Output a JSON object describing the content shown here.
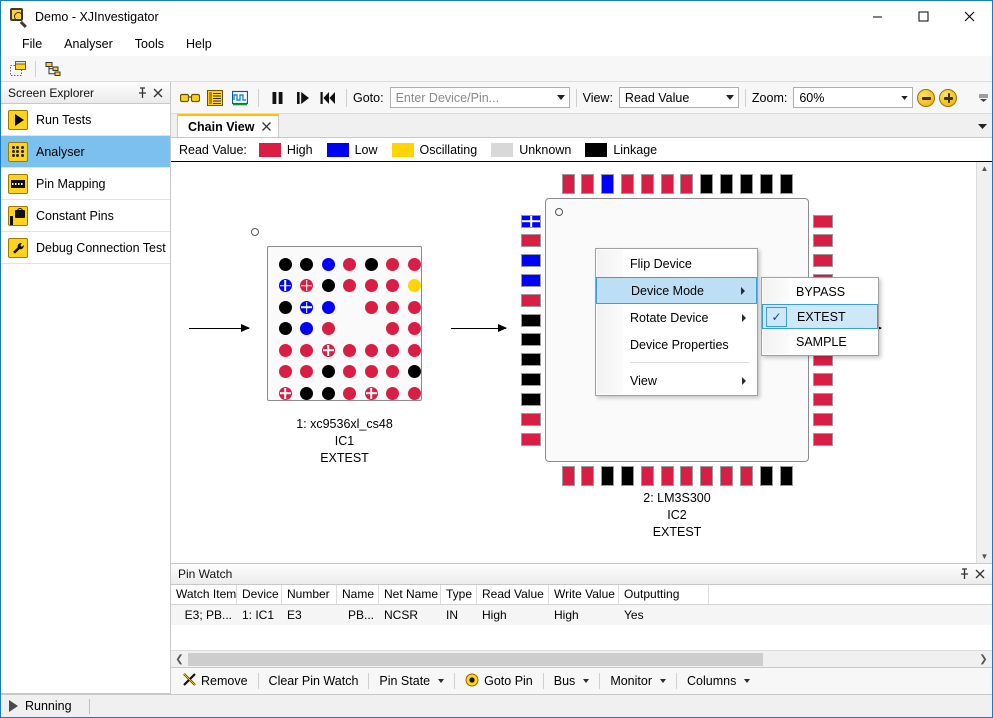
{
  "window": {
    "title": "Demo - XJInvestigator",
    "app_icon": "magnifier-icon",
    "minimize": "minimize-icon",
    "maximize": "maximize-icon",
    "close": "close-icon"
  },
  "menubar": {
    "items": [
      "File",
      "Analyser",
      "Tools",
      "Help"
    ]
  },
  "top_toolbar": {
    "buttons": [
      "screen-explorer-icon",
      "hierarchy-icon"
    ]
  },
  "sidebar": {
    "title": "Screen Explorer",
    "pin_icon": "pin-icon",
    "close_icon": "close-icon",
    "items": [
      {
        "label": "Run Tests",
        "icon": "run-tests-icon",
        "selected": false
      },
      {
        "label": "Analyser",
        "icon": "analyser-icon",
        "selected": true
      },
      {
        "label": "Pin Mapping",
        "icon": "pin-mapping-icon",
        "selected": false
      },
      {
        "label": "Constant Pins",
        "icon": "constant-pins-icon",
        "selected": false
      },
      {
        "label": "Debug Connection Test",
        "icon": "debug-connection-icon",
        "selected": false
      }
    ]
  },
  "main_toolbar": {
    "icon_buttons": [
      "glasses-icon",
      "list-view-icon",
      "waveform-icon"
    ],
    "transport_buttons": [
      "pause-icon",
      "step-icon",
      "rewind-icon"
    ],
    "goto_label": "Goto:",
    "goto_placeholder": "Enter Device/Pin...",
    "goto_value": "",
    "view_label": "View:",
    "view_value": "Read Value",
    "zoom_label": "Zoom:",
    "zoom_value": "60%",
    "zoom_out_icon": "zoom-out-icon",
    "zoom_in_icon": "zoom-in-icon",
    "overflow_icon": "toolbar-overflow-icon"
  },
  "tabs": {
    "items": [
      {
        "label": "Chain View",
        "close_icon": "close-icon",
        "active": true
      }
    ],
    "dropdown_icon": "chevron-down-icon"
  },
  "legend": {
    "title": "Read Value:",
    "items": [
      {
        "label": "High",
        "color": "#D81E45"
      },
      {
        "label": "Low",
        "color": "#0000FF"
      },
      {
        "label": "Oscillating",
        "color": "#FFD400"
      },
      {
        "label": "Unknown",
        "color": "#D8D8D8"
      },
      {
        "label": "Linkage",
        "color": "#000000"
      }
    ]
  },
  "canvas": {
    "device1": {
      "name": "1: xc9536xl_cs48",
      "ref": "IC1",
      "mode": "EXTEST",
      "package": "BGA",
      "grid": [
        [
          "K",
          "K",
          "L",
          "H",
          "K",
          "H",
          "H"
        ],
        [
          "Lx",
          "Hx",
          "K",
          "H",
          "H",
          "H",
          "O"
        ],
        [
          "K",
          "Lx",
          "L",
          "",
          "H",
          "H",
          "H"
        ],
        [
          "K",
          "L",
          "H",
          "",
          "",
          "H",
          "H"
        ],
        [
          "H",
          "H",
          "Hx",
          "H",
          "H",
          "H",
          "H"
        ],
        [
          "H",
          "H",
          "K",
          "H",
          "H",
          "H",
          "K"
        ],
        [
          "Hx",
          "K",
          "K",
          "H",
          "Hx",
          "H",
          "H"
        ]
      ]
    },
    "device2": {
      "name": "2: LM3S300",
      "ref": "IC2",
      "mode": "EXTEST",
      "package": "QFP",
      "top_pins": [
        "H",
        "H",
        "L",
        "H",
        "H",
        "H",
        "H",
        "K",
        "K",
        "K",
        "K",
        "K"
      ],
      "bottom_pins": [
        "H",
        "H",
        "K",
        "K",
        "H",
        "H",
        "H",
        "H",
        "H",
        "H",
        "K",
        "K"
      ],
      "left_pins": [
        "Lx",
        "H",
        "L",
        "L",
        "H",
        "K",
        "K",
        "K",
        "K",
        "K",
        "H",
        "H"
      ],
      "right_pins": [
        "H",
        "H",
        "H",
        "H",
        "H",
        "H",
        "H",
        "H",
        "H",
        "H",
        "H",
        "H"
      ]
    }
  },
  "context_menu": {
    "items": [
      {
        "label": "Flip Device",
        "has_submenu": false,
        "highlighted": false,
        "separator_after": false
      },
      {
        "label": "Device Mode",
        "has_submenu": true,
        "highlighted": true,
        "separator_after": false
      },
      {
        "label": "Rotate Device",
        "has_submenu": true,
        "highlighted": false,
        "separator_after": false
      },
      {
        "label": "Device Properties",
        "has_submenu": false,
        "highlighted": false,
        "separator_after": true
      },
      {
        "label": "View",
        "has_submenu": true,
        "highlighted": false,
        "separator_after": false
      }
    ],
    "submenu": {
      "items": [
        {
          "label": "BYPASS",
          "checked": false,
          "highlighted": false
        },
        {
          "label": "EXTEST",
          "checked": true,
          "highlighted": true
        },
        {
          "label": "SAMPLE",
          "checked": false,
          "highlighted": false
        }
      ]
    }
  },
  "pin_watch": {
    "title": "Pin Watch",
    "pin_icon": "pin-icon",
    "close_icon": "close-icon",
    "columns": [
      "Watch Item",
      "Device",
      "Number",
      "Name",
      "Net Name",
      "Type",
      "Read Value",
      "Write Value",
      "Outputting"
    ],
    "rows": [
      {
        "watch_item": "E3; PB...",
        "device": "1: IC1",
        "number": "E3",
        "name": "PB...",
        "net_name": "NCSR",
        "type": "IN",
        "read_value": "High",
        "write_value": "High",
        "outputting": "Yes"
      }
    ],
    "toolbar": [
      {
        "label": "Remove",
        "icon": "remove-x-icon",
        "caret": false
      },
      {
        "label": "Clear Pin Watch",
        "icon": "",
        "caret": false
      },
      {
        "label": "Pin State",
        "icon": "",
        "caret": true
      },
      {
        "label": "Goto Pin",
        "icon": "goto-pin-icon",
        "caret": false
      },
      {
        "label": "Bus",
        "icon": "",
        "caret": true
      },
      {
        "label": "Monitor",
        "icon": "",
        "caret": true
      },
      {
        "label": "Columns",
        "icon": "",
        "caret": true
      }
    ]
  },
  "status_bar": {
    "icon": "play-icon",
    "text": "Running"
  },
  "colors": {
    "high": "#D81E45",
    "low": "#0000FF",
    "oscillating": "#FFD400",
    "unknown": "#D8D8D8",
    "linkage": "#000000",
    "selection": "#7cc0ee",
    "accent": "#ffc000"
  }
}
